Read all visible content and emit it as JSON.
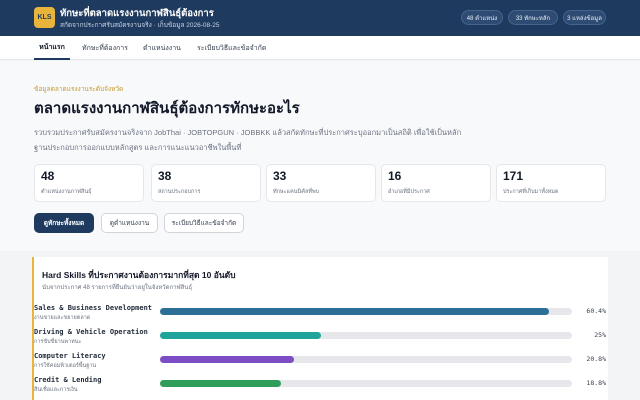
{
  "header": {
    "logo_text": "KLS",
    "title": "ทักษะที่ตลาดแรงงานกาฬสินธุ์ต้องการ",
    "subtitle": "สกัดจากประกาศรับสมัครงานจริง · เก็บข้อมูล 2026-08-25",
    "badges": [
      "48 ตำแหน่ง",
      "33 ทักษะหลัก",
      "3 แหล่งข้อมูล"
    ]
  },
  "nav": {
    "tabs": [
      "หน้าแรก",
      "ทักษะที่ต้องการ",
      "ตำแหน่งงาน",
      "ระเบียบวิธีและข้อจำกัด"
    ],
    "active_index": 0
  },
  "hero": {
    "eyebrow": "ข้อมูลตลาดแรงงานระดับจังหวัด",
    "title": "ตลาดแรงงานกาฬสินธุ์ต้องการทักษะอะไร",
    "description": "รวบรวมประกาศรับสมัครงานจริงจาก JobThai · JOBTOPGUN · JOBBKK แล้วสกัดทักษะที่ประกาศระบุออกมาเป็นสถิติ เพื่อใช้เป็นหลักฐานประกอบการออกแบบหลักสูตร และการแนะแนวอาชีพในพื้นที่"
  },
  "stats": [
    {
      "value": "48",
      "label": "ตำแหน่งงานกาฬสินธุ์"
    },
    {
      "value": "38",
      "label": "สถานประกอบการ"
    },
    {
      "value": "33",
      "label": "ทักษะแคนนิคัลที่พบ"
    },
    {
      "value": "16",
      "label": "อำเภอที่มีประกาศ"
    },
    {
      "value": "171",
      "label": "ประกาศที่เก็บมาทั้งหมด"
    }
  ],
  "actions": {
    "primary": "ดูทักษะทั้งหมด",
    "jobs": "ดูตำแหน่งงาน",
    "method": "ระเบียบวิธีและข้อจำกัด"
  },
  "skills_section": {
    "title": "Hard Skills ที่ประกาศงานต้องการมากที่สุด 10 อันดับ",
    "subtitle": "นับจากประกาศ 48 รายการที่ยืนยันว่าอยู่ในจังหวัดกาฬสินธุ์",
    "items": [
      {
        "name": "Sales & Business Development",
        "name_th": "งานขายและขยายตลาด",
        "percent": 60.4,
        "percent_label": "60.4%",
        "color": "#2b6f97"
      },
      {
        "name": "Driving & Vehicle Operation",
        "name_th": "การขับขี่ยานพาหนะ",
        "percent": 25,
        "percent_label": "25%",
        "color": "#1fa39a"
      },
      {
        "name": "Computer Literacy",
        "name_th": "การใช้คอมพิวเตอร์พื้นฐาน",
        "percent": 20.8,
        "percent_label": "20.8%",
        "color": "#7c4dc4"
      },
      {
        "name": "Credit & Lending",
        "name_th": "สินเชื่อและการเงิน",
        "percent": 18.8,
        "percent_label": "18.8%",
        "color": "#2f9e5b"
      }
    ]
  }
}
